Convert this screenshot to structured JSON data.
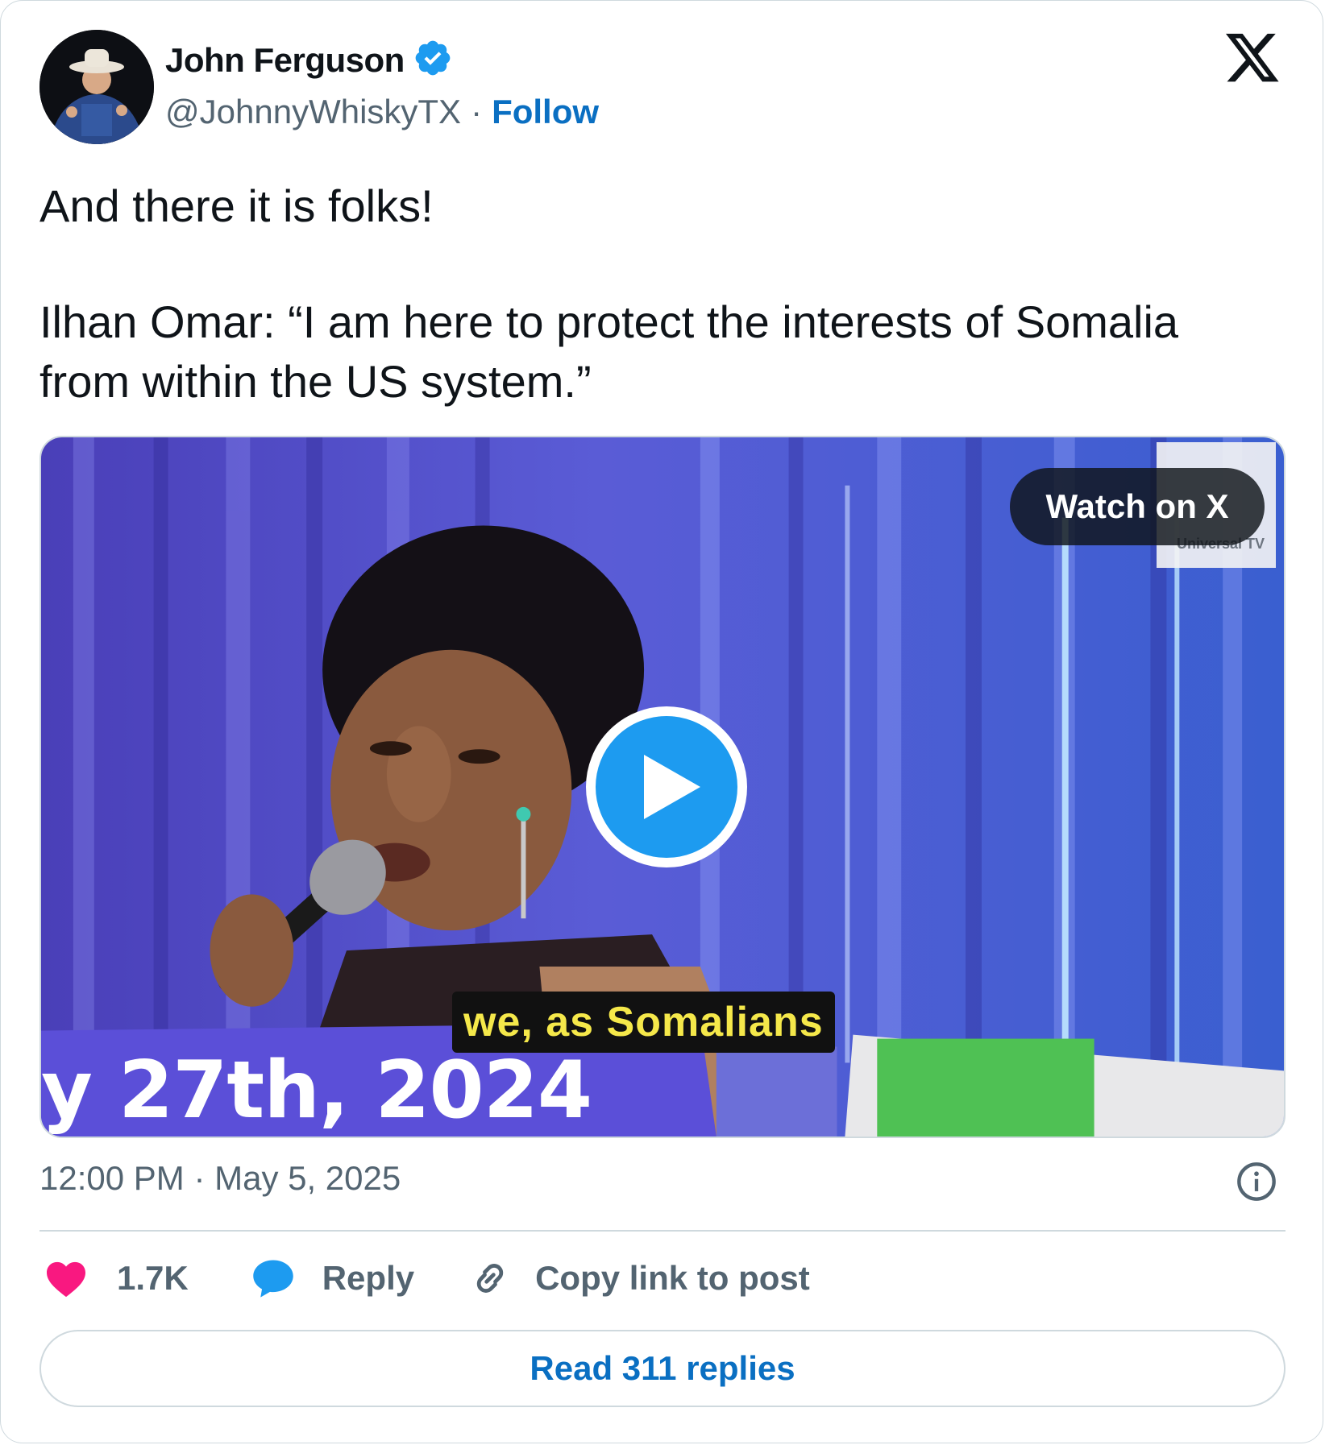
{
  "author": {
    "name": "John Ferguson",
    "handle": "@JohnnyWhiskyTX",
    "separator": "·",
    "follow_label": "Follow",
    "verified": true,
    "verified_color": "#1d9bf0"
  },
  "tweet": {
    "line1": "And there it is folks!",
    "line2": "Ilhan Omar: “I am here to protect the interests of Somalia from within the US system.”"
  },
  "media": {
    "watch_label": "Watch on X",
    "caption": "we, as Somalians",
    "banner_text": "y 27th, 2024",
    "logo_text": "Universal TV",
    "play_color": "#1d9bf0"
  },
  "meta": {
    "timestamp": "12:00 PM · May 5, 2025"
  },
  "actions": {
    "like_count": "1.7K",
    "like_color": "#f91880",
    "reply_label": "Reply",
    "reply_color": "#1d9bf0",
    "copy_label": "Copy link to post"
  },
  "footer": {
    "read_replies_label": "Read 311 replies"
  }
}
